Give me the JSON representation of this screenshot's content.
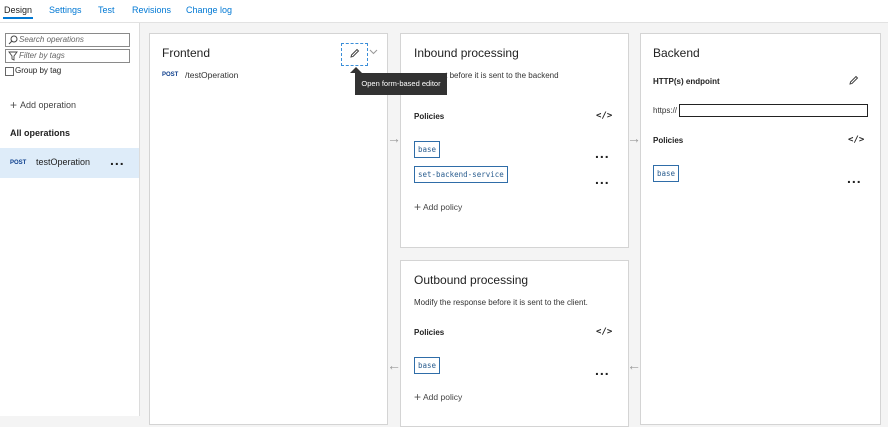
{
  "tabs": [
    {
      "label": "Design"
    },
    {
      "label": "Settings"
    },
    {
      "label": "Test"
    },
    {
      "label": "Revisions"
    },
    {
      "label": "Change log"
    }
  ],
  "left_panel": {
    "search_placeholder": "Search operations",
    "filter_placeholder": "Filter by tags",
    "group_by_tag": "Group by tag",
    "add_operation": "Add operation",
    "all_operations": "All operations",
    "operations": [
      {
        "method": "POST",
        "name": "testOperation",
        "more": "..."
      }
    ]
  },
  "frontend": {
    "title": "Frontend",
    "method": "POST",
    "path": "/testOperation",
    "tooltip": "Open form-based editor"
  },
  "inbound": {
    "title": "Inbound processing",
    "description_visible": "e request before it is sent to the backend",
    "policies_label": "Policies",
    "code_icon": "</>",
    "policies": [
      {
        "name": "base",
        "more": "..."
      },
      {
        "name": "set-backend-service",
        "more": "..."
      }
    ],
    "add_policy": "Add policy"
  },
  "outbound": {
    "title": "Outbound processing",
    "description": "Modify the response before it is sent to the client.",
    "policies_label": "Policies",
    "code_icon": "</>",
    "policies": [
      {
        "name": "base",
        "more": "..."
      }
    ],
    "add_policy": "Add policy"
  },
  "backend": {
    "title": "Backend",
    "endpoint_label": "HTTP(s) endpoint",
    "url_prefix": "https://",
    "url_value": "",
    "policies_label": "Policies",
    "code_icon": "</>",
    "policies": [
      {
        "name": "base",
        "more": "..."
      }
    ]
  },
  "arrows": {
    "right": "→",
    "left": "←"
  },
  "colors": {
    "accent": "#0078d4",
    "selected_row": "#deecf9",
    "tooltip_bg": "#323232",
    "chip_border": "#2f6da8"
  }
}
